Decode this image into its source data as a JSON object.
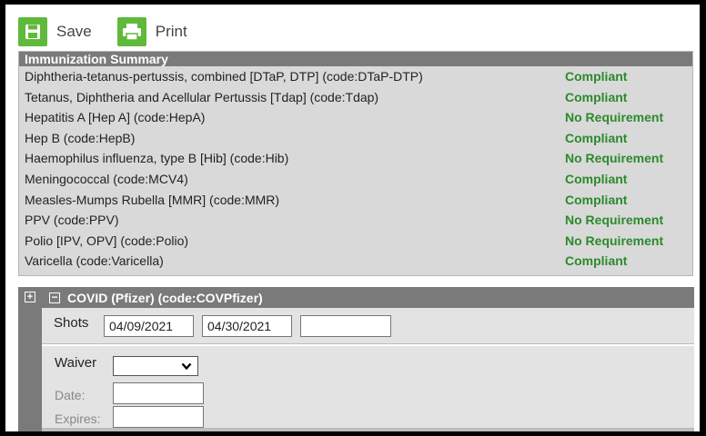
{
  "toolbar": {
    "save_label": "Save",
    "print_label": "Print",
    "icons": {
      "save": "floppy-disk-icon",
      "print": "printer-icon"
    },
    "icon_color": "#5fba3b"
  },
  "summary": {
    "title": "Immunization Summary",
    "rows": [
      {
        "name": "Diphtheria-tetanus-pertussis, combined [DTaP, DTP] (code:DTaP-DTP)",
        "status": "Compliant"
      },
      {
        "name": "Tetanus, Diphtheria and Acellular Pertussis [Tdap] (code:Tdap)",
        "status": "Compliant"
      },
      {
        "name": "Hepatitis A [Hep A] (code:HepA)",
        "status": "No Requirement"
      },
      {
        "name": "Hep B (code:HepB)",
        "status": "Compliant"
      },
      {
        "name": "Haemophilus influenza, type B [Hib] (code:Hib)",
        "status": "No Requirement"
      },
      {
        "name": "Meningococcal (code:MCV4)",
        "status": "Compliant"
      },
      {
        "name": "Measles-Mumps Rubella [MMR] (code:MMR)",
        "status": "Compliant"
      },
      {
        "name": "PPV (code:PPV)",
        "status": "No Requirement"
      },
      {
        "name": "Polio [IPV, OPV] (code:Polio)",
        "status": "No Requirement"
      },
      {
        "name": "Varicella (code:Varicella)",
        "status": "Compliant"
      }
    ],
    "status_color": "#2b8a2b"
  },
  "covid": {
    "expand_symbol": "+",
    "collapse_symbol": "−",
    "title": "COVID (Pfizer) (code:COVPfizer)",
    "shots_label": "Shots",
    "shots": [
      "04/09/2021",
      "04/30/2021",
      ""
    ],
    "waiver_label": "Waiver",
    "waiver_value": "",
    "date_label": "Date:",
    "date_value": "",
    "expires_label": "Expires:",
    "expires_value": ""
  }
}
